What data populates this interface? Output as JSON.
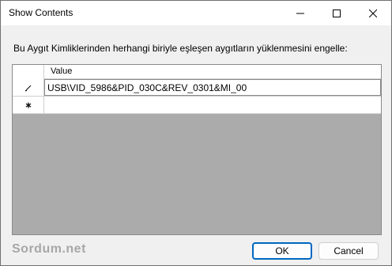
{
  "window": {
    "title": "Show Contents"
  },
  "prompt": "Bu Aygıt Kimliklerinden herhangi biriyle eşleşen aygıtların yüklenmesini engelle:",
  "grid": {
    "column_header": "Value",
    "rows": [
      {
        "value": "USB\\VID_5986&PID_030C&REV_0301&MI_00",
        "row_icon": "pencil-icon"
      },
      {
        "value": "",
        "row_icon": "asterisk-icon"
      }
    ]
  },
  "watermark": "Sordum.net",
  "buttons": {
    "ok": "OK",
    "cancel": "Cancel"
  },
  "colors": {
    "accent": "#0067c0",
    "window_bg": "#f0f0f0",
    "grid_bg": "#ababab"
  }
}
